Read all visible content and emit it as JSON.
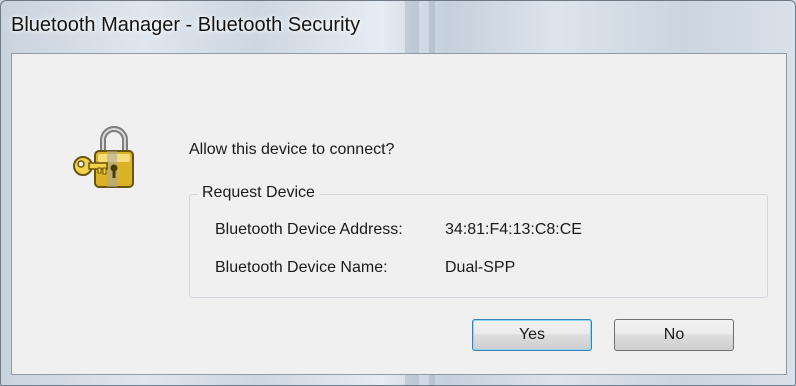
{
  "window": {
    "title": "Bluetooth Manager - Bluetooth Security"
  },
  "dialog": {
    "icon": "padlock-with-key-icon",
    "prompt": "Allow this device to connect?",
    "group_title": "Request Device",
    "fields": [
      {
        "label": "Bluetooth Device Address:",
        "value": "34:81:F4:13:C8:CE"
      },
      {
        "label": "Bluetooth Device Name:",
        "value": "Dual-SPP"
      }
    ],
    "buttons": {
      "yes_label": "Yes",
      "no_label": "No"
    }
  },
  "colors": {
    "client_background": "#f0f0f0",
    "default_button_border": "#3c7fb1",
    "lock_gold": "#e1b62a"
  }
}
